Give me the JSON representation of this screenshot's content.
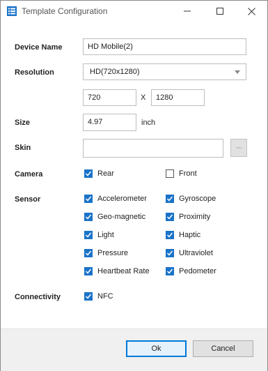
{
  "window": {
    "title": "Template Configuration",
    "icon": "list-icon"
  },
  "labels": {
    "device_name": "Device Name",
    "resolution": "Resolution",
    "size": "Size",
    "skin": "Skin",
    "camera": "Camera",
    "sensor": "Sensor",
    "connectivity": "Connectivity"
  },
  "device_name": {
    "value": "HD Mobile(2)"
  },
  "resolution": {
    "selected": "HD(720x1280)",
    "width": "720",
    "separator": "X",
    "height": "1280"
  },
  "size": {
    "value": "4.97",
    "unit": "inch"
  },
  "skin": {
    "value": "",
    "browse_label": "···"
  },
  "camera": [
    {
      "label": "Rear",
      "checked": true
    },
    {
      "label": "Front",
      "checked": false
    }
  ],
  "sensors": [
    {
      "label": "Accelerometer",
      "checked": true
    },
    {
      "label": "Gyroscope",
      "checked": true
    },
    {
      "label": "Geo-magnetic",
      "checked": true
    },
    {
      "label": "Proximity",
      "checked": true
    },
    {
      "label": "Light",
      "checked": true
    },
    {
      "label": "Haptic",
      "checked": true
    },
    {
      "label": "Pressure",
      "checked": true
    },
    {
      "label": "Ultraviolet",
      "checked": true
    },
    {
      "label": "Heartbeat Rate",
      "checked": true
    },
    {
      "label": "Pedometer",
      "checked": true
    }
  ],
  "connectivity": [
    {
      "label": "NFC",
      "checked": true
    }
  ],
  "buttons": {
    "ok": "Ok",
    "cancel": "Cancel"
  },
  "colors": {
    "accent": "#1a73c8",
    "primary_border": "#0078d7",
    "footer_bg": "#f0f0f0"
  }
}
